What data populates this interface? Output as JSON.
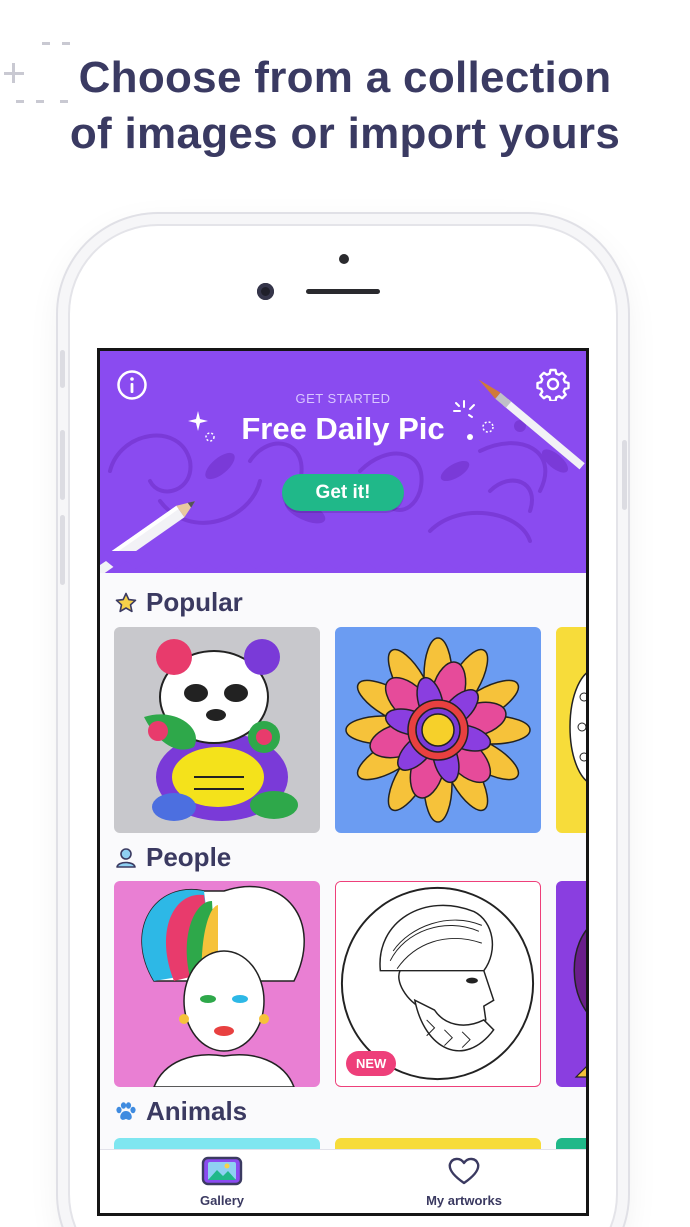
{
  "headline": {
    "line1": "Choose from a collection",
    "line2": "of images or import yours"
  },
  "banner": {
    "eyebrow": "GET STARTED",
    "title": "Free Daily Pic",
    "cta_label": "Get it!",
    "info_icon": "info-icon",
    "settings_icon": "gear-icon",
    "color": "#8a4bf0"
  },
  "sections": {
    "popular": {
      "title": "Popular",
      "icon": "star-icon"
    },
    "people": {
      "title": "People",
      "icon": "person-icon"
    },
    "animals": {
      "title": "Animals",
      "icon": "paw-icon"
    }
  },
  "badges": {
    "new": "NEW"
  },
  "tabbar": {
    "gallery": {
      "label": "Gallery",
      "icon": "gallery-icon"
    },
    "artworks": {
      "label": "My artworks",
      "icon": "heart-icon"
    }
  },
  "colors": {
    "accent": "#8a4bf0",
    "cta": "#20b889",
    "new_badge": "#ee3f7a",
    "heading": "#3b3a61"
  }
}
